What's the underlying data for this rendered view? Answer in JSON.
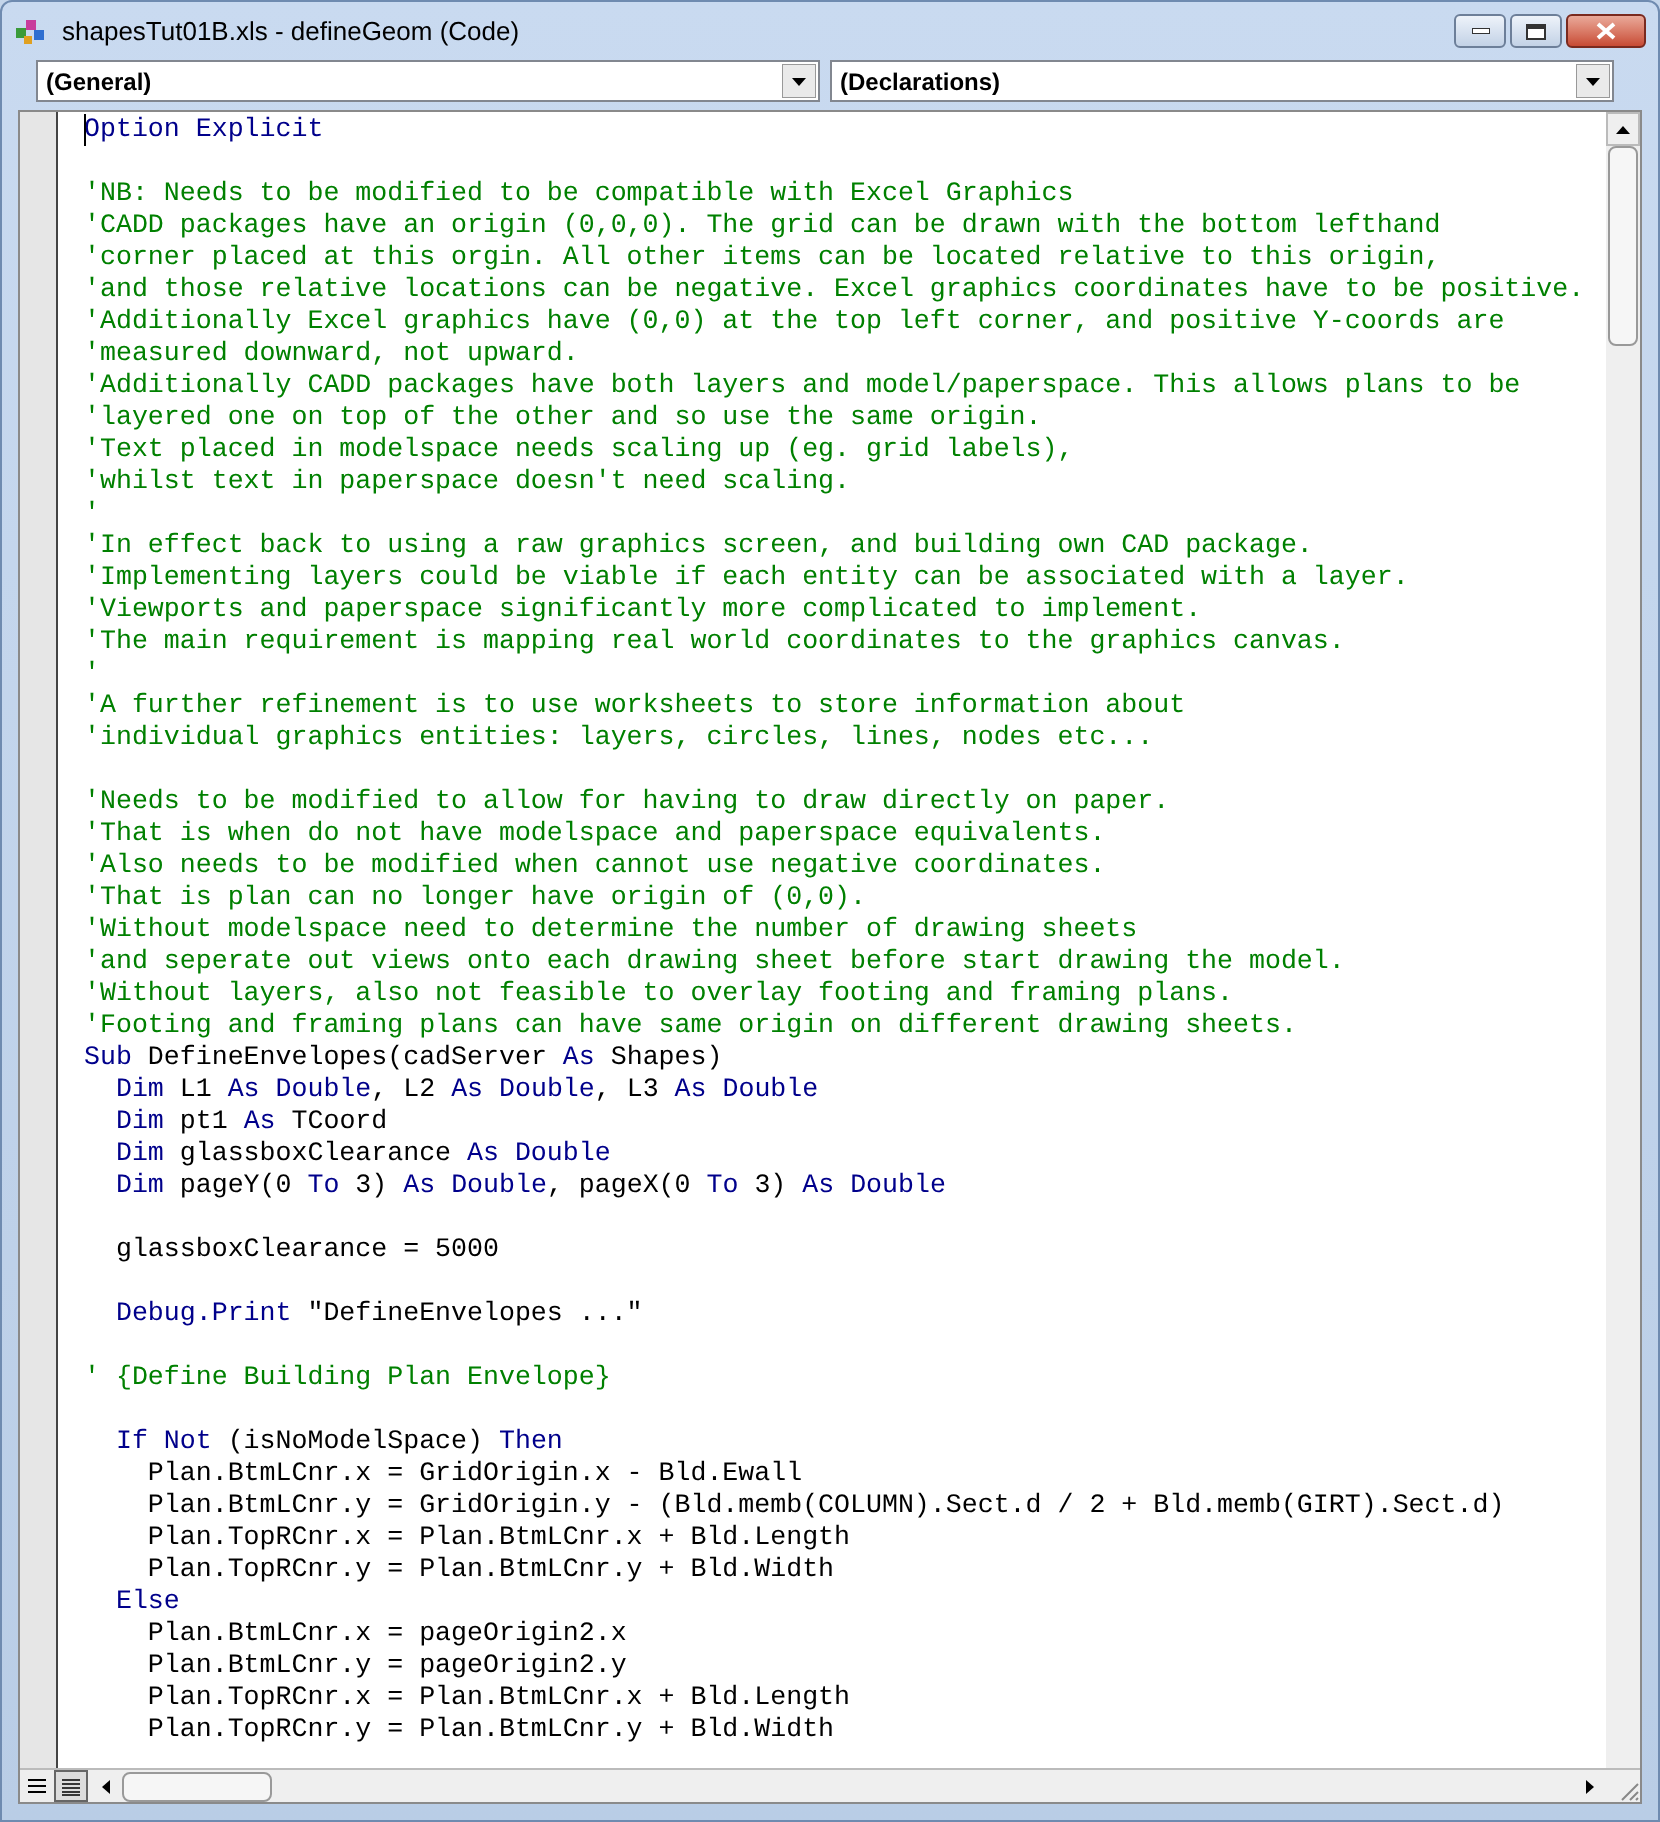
{
  "window": {
    "title": "shapesTut01B.xls - defineGeom (Code)"
  },
  "object_dropdown": {
    "value": "(General)"
  },
  "procedure_dropdown": {
    "value": "(Declarations)"
  },
  "code_lines": [
    {
      "kind": "code",
      "caret": true,
      "tokens": [
        {
          "kind": "kw",
          "text": "Option Explicit"
        }
      ]
    },
    {
      "kind": "blank"
    },
    {
      "kind": "code",
      "tokens": [
        {
          "kind": "comment",
          "text": "'NB: Needs to be modified to be compatible with Excel Graphics"
        }
      ]
    },
    {
      "kind": "code",
      "tokens": [
        {
          "kind": "comment",
          "text": "'CADD packages have an origin (0,0,0). The grid can be drawn with the bottom lefthand"
        }
      ]
    },
    {
      "kind": "code",
      "tokens": [
        {
          "kind": "comment",
          "text": "'corner placed at this orgin. All other items can be located relative to this origin,"
        }
      ]
    },
    {
      "kind": "code",
      "tokens": [
        {
          "kind": "comment",
          "text": "'and those relative locations can be negative. Excel graphics coordinates have to be positive."
        }
      ]
    },
    {
      "kind": "code",
      "tokens": [
        {
          "kind": "comment",
          "text": "'Additionally Excel graphics have (0,0) at the top left corner, and positive Y-coords are"
        }
      ]
    },
    {
      "kind": "code",
      "tokens": [
        {
          "kind": "comment",
          "text": "'measured downward, not upward."
        }
      ]
    },
    {
      "kind": "code",
      "tokens": [
        {
          "kind": "comment",
          "text": "'Additionally CADD packages have both layers and model/paperspace. This allows plans to be"
        }
      ]
    },
    {
      "kind": "code",
      "tokens": [
        {
          "kind": "comment",
          "text": "'layered one on top of the other and so use the same origin."
        }
      ]
    },
    {
      "kind": "code",
      "tokens": [
        {
          "kind": "comment",
          "text": "'Text placed in modelspace needs scaling up (eg. grid labels),"
        }
      ]
    },
    {
      "kind": "code",
      "tokens": [
        {
          "kind": "comment",
          "text": "'whilst text in paperspace doesn't need scaling."
        }
      ]
    },
    {
      "kind": "code",
      "tokens": [
        {
          "kind": "comment",
          "text": "'"
        }
      ]
    },
    {
      "kind": "code",
      "tokens": [
        {
          "kind": "comment",
          "text": "'In effect back to using a raw graphics screen, and building own CAD package."
        }
      ]
    },
    {
      "kind": "code",
      "tokens": [
        {
          "kind": "comment",
          "text": "'Implementing layers could be viable if each entity can be associated with a layer."
        }
      ]
    },
    {
      "kind": "code",
      "tokens": [
        {
          "kind": "comment",
          "text": "'Viewports and paperspace significantly more complicated to implement."
        }
      ]
    },
    {
      "kind": "code",
      "tokens": [
        {
          "kind": "comment",
          "text": "'The main requirement is mapping real world coordinates to the graphics canvas."
        }
      ]
    },
    {
      "kind": "code",
      "tokens": [
        {
          "kind": "comment",
          "text": "'"
        }
      ]
    },
    {
      "kind": "code",
      "tokens": [
        {
          "kind": "comment",
          "text": "'A further refinement is to use worksheets to store information about"
        }
      ]
    },
    {
      "kind": "code",
      "tokens": [
        {
          "kind": "comment",
          "text": "'individual graphics entities: layers, circles, lines, nodes etc..."
        }
      ]
    },
    {
      "kind": "blank"
    },
    {
      "kind": "code",
      "tokens": [
        {
          "kind": "comment",
          "text": "'Needs to be modified to allow for having to draw directly on paper."
        }
      ]
    },
    {
      "kind": "code",
      "tokens": [
        {
          "kind": "comment",
          "text": "'That is when do not have modelspace and paperspace equivalents."
        }
      ]
    },
    {
      "kind": "code",
      "tokens": [
        {
          "kind": "comment",
          "text": "'Also needs to be modified when cannot use negative coordinates."
        }
      ]
    },
    {
      "kind": "code",
      "tokens": [
        {
          "kind": "comment",
          "text": "'That is plan can no longer have origin of (0,0)."
        }
      ]
    },
    {
      "kind": "code",
      "tokens": [
        {
          "kind": "comment",
          "text": "'Without modelspace need to determine the number of drawing sheets"
        }
      ]
    },
    {
      "kind": "code",
      "tokens": [
        {
          "kind": "comment",
          "text": "'and seperate out views onto each drawing sheet before start drawing the model."
        }
      ]
    },
    {
      "kind": "code",
      "tokens": [
        {
          "kind": "comment",
          "text": "'Without layers, also not feasible to overlay footing and framing plans."
        }
      ]
    },
    {
      "kind": "code",
      "tokens": [
        {
          "kind": "comment",
          "text": "'Footing and framing plans can have same origin on different drawing sheets."
        }
      ]
    },
    {
      "kind": "code",
      "tokens": [
        {
          "kind": "kw",
          "text": "Sub"
        },
        {
          "kind": "text",
          "text": " DefineEnvelopes(cadServer "
        },
        {
          "kind": "kw",
          "text": "As"
        },
        {
          "kind": "text",
          "text": " Shapes)"
        }
      ]
    },
    {
      "kind": "code",
      "tokens": [
        {
          "kind": "kw",
          "text": "  Dim"
        },
        {
          "kind": "text",
          "text": " L1 "
        },
        {
          "kind": "kw",
          "text": "As Double"
        },
        {
          "kind": "text",
          "text": ", L2 "
        },
        {
          "kind": "kw",
          "text": "As Double"
        },
        {
          "kind": "text",
          "text": ", L3 "
        },
        {
          "kind": "kw",
          "text": "As Double"
        }
      ]
    },
    {
      "kind": "code",
      "tokens": [
        {
          "kind": "kw",
          "text": "  Dim"
        },
        {
          "kind": "text",
          "text": " pt1 "
        },
        {
          "kind": "kw",
          "text": "As"
        },
        {
          "kind": "text",
          "text": " TCoord"
        }
      ]
    },
    {
      "kind": "code",
      "tokens": [
        {
          "kind": "kw",
          "text": "  Dim"
        },
        {
          "kind": "text",
          "text": " glassboxClearance "
        },
        {
          "kind": "kw",
          "text": "As Double"
        }
      ]
    },
    {
      "kind": "code",
      "tokens": [
        {
          "kind": "kw",
          "text": "  Dim"
        },
        {
          "kind": "text",
          "text": " pageY(0 "
        },
        {
          "kind": "kw",
          "text": "To"
        },
        {
          "kind": "text",
          "text": " 3) "
        },
        {
          "kind": "kw",
          "text": "As Double"
        },
        {
          "kind": "text",
          "text": ", pageX(0 "
        },
        {
          "kind": "kw",
          "text": "To"
        },
        {
          "kind": "text",
          "text": " 3) "
        },
        {
          "kind": "kw",
          "text": "As Double"
        }
      ]
    },
    {
      "kind": "blank"
    },
    {
      "kind": "code",
      "tokens": [
        {
          "kind": "text",
          "text": "  glassboxClearance = 5000"
        }
      ]
    },
    {
      "kind": "blank"
    },
    {
      "kind": "code",
      "tokens": [
        {
          "kind": "kw",
          "text": "  Debug.Print"
        },
        {
          "kind": "text",
          "text": " \"DefineEnvelopes ...\""
        }
      ]
    },
    {
      "kind": "blank"
    },
    {
      "kind": "code",
      "tokens": [
        {
          "kind": "comment",
          "text": "' {Define Building Plan Envelope}"
        }
      ]
    },
    {
      "kind": "blank"
    },
    {
      "kind": "code",
      "tokens": [
        {
          "kind": "kw",
          "text": "  If Not"
        },
        {
          "kind": "text",
          "text": " (isNoModelSpace) "
        },
        {
          "kind": "kw",
          "text": "Then"
        }
      ]
    },
    {
      "kind": "code",
      "tokens": [
        {
          "kind": "text",
          "text": "    Plan.BtmLCnr.x = GridOrigin.x - Bld.Ewall"
        }
      ]
    },
    {
      "kind": "code",
      "tokens": [
        {
          "kind": "text",
          "text": "    Plan.BtmLCnr.y = GridOrigin.y - (Bld.memb(COLUMN).Sect.d / 2 + Bld.memb(GIRT).Sect.d)"
        }
      ]
    },
    {
      "kind": "code",
      "tokens": [
        {
          "kind": "text",
          "text": "    Plan.TopRCnr.x = Plan.BtmLCnr.x + Bld.Length"
        }
      ]
    },
    {
      "kind": "code",
      "tokens": [
        {
          "kind": "text",
          "text": "    Plan.TopRCnr.y = Plan.BtmLCnr.y + Bld.Width"
        }
      ]
    },
    {
      "kind": "code",
      "tokens": [
        {
          "kind": "kw",
          "text": "  Else"
        }
      ]
    },
    {
      "kind": "code",
      "tokens": [
        {
          "kind": "text",
          "text": "    Plan.BtmLCnr.x = pageOrigin2.x"
        }
      ]
    },
    {
      "kind": "code",
      "tokens": [
        {
          "kind": "text",
          "text": "    Plan.BtmLCnr.y = pageOrigin2.y"
        }
      ]
    },
    {
      "kind": "code",
      "tokens": [
        {
          "kind": "text",
          "text": "    Plan.TopRCnr.x = Plan.BtmLCnr.x + Bld.Length"
        }
      ]
    },
    {
      "kind": "code",
      "tokens": [
        {
          "kind": "text",
          "text": "    Plan.TopRCnr.y = Plan.BtmLCnr.y + Bld.Width"
        }
      ]
    }
  ]
}
